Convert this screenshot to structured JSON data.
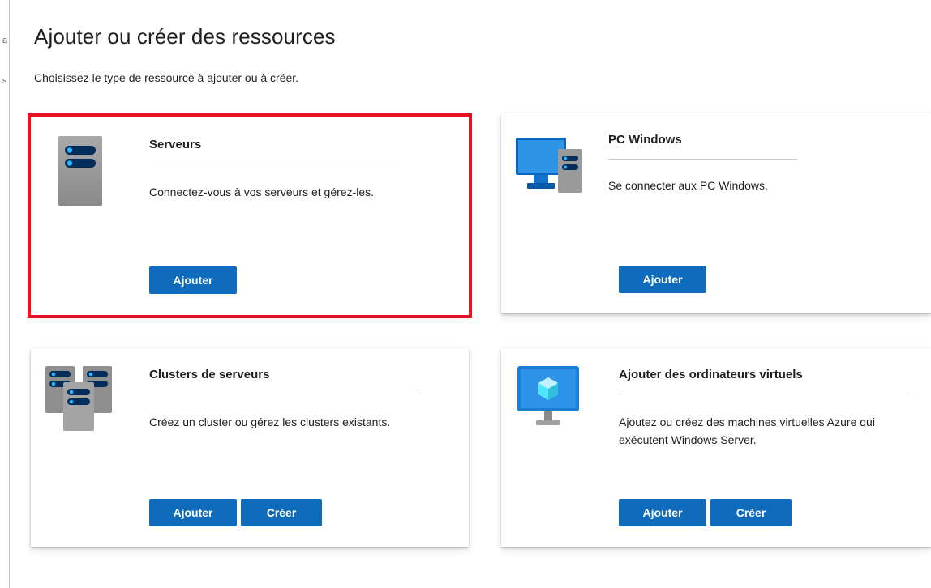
{
  "page": {
    "title": "Ajouter ou créer des ressources",
    "subtitle": "Choisissez le type de ressource à ajouter ou à créer."
  },
  "left_edge": {
    "fragment_1": "a",
    "fragment_2": "s"
  },
  "cards": {
    "servers": {
      "title": "Serveurs",
      "description": "Connectez-vous à vos serveurs et gérez-les.",
      "add_label": "Ajouter",
      "icon": "server-icon",
      "selected": true
    },
    "windows_pcs": {
      "title": "PC Windows",
      "description": "Se connecter aux PC Windows.",
      "add_label": "Ajouter",
      "icon": "windows-pc-icon"
    },
    "clusters": {
      "title": "Clusters de serveurs",
      "description": "Créez un cluster ou gérez les clusters existants.",
      "add_label": "Ajouter",
      "create_label": "Créer",
      "icon": "server-cluster-icon"
    },
    "virtual_machines": {
      "title": "Ajouter des ordinateurs virtuels",
      "description": "Ajoutez ou créez des machines virtuelles Azure qui exécutent Windows Server.",
      "add_label": "Ajouter",
      "create_label": "Créer",
      "icon": "azure-vm-icon"
    }
  },
  "colors": {
    "primary_button": "#0f6cbd",
    "selection_outline": "#e81123",
    "icon_blue": "#0078d4",
    "server_gray": "#949494"
  }
}
